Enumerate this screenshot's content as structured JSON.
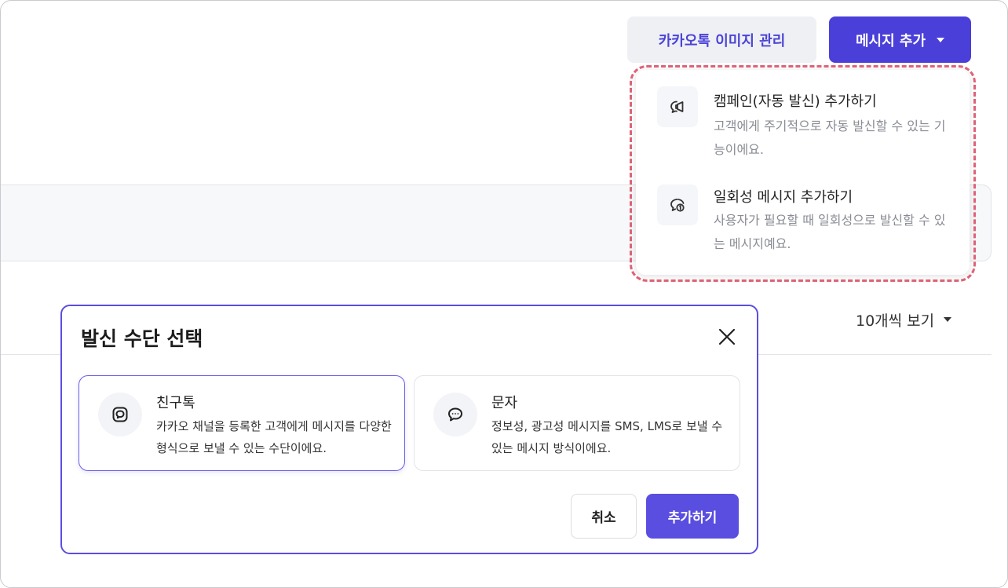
{
  "header": {
    "manage_images_label": "카카오톡 이미지 관리",
    "add_message_label": "메시지 추가"
  },
  "dropdown": {
    "items": [
      {
        "title": "캠페인(자동 발신) 추가하기",
        "desc": "고객에게 주기적으로 자동 발신할 수 있는 기능이에요.",
        "icon": "campaign-icon"
      },
      {
        "title": "일회성 메시지 추가하기",
        "desc": "사용자가 필요할 때 일회성으로 발신할 수 있는 메시지예요.",
        "icon": "one-time-message-icon"
      }
    ]
  },
  "list": {
    "page_size_label": "10개씩 보기"
  },
  "modal": {
    "title": "발신 수단 선택",
    "options": [
      {
        "title": "친구톡",
        "desc": "카카오 채널을 등록한 고객에게 메시지를 다양한 형식으로 보낼 수 있는 수단이에요.",
        "icon": "friendtalk-icon",
        "selected": true
      },
      {
        "title": "문자",
        "desc": "정보성, 광고성 메시지를 SMS, LMS로 보낼 수 있는 메시지 방식이에요.",
        "icon": "sms-icon",
        "selected": false
      }
    ],
    "cancel_label": "취소",
    "confirm_label": "추가하기"
  },
  "colors": {
    "accent": "#4a3fd8",
    "highlight_outline": "#e06478"
  }
}
